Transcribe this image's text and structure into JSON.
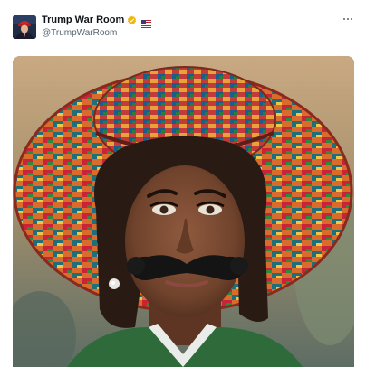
{
  "post": {
    "author": {
      "display_name": "Trump War Room",
      "handle": "@TrumpWarRoom",
      "verified_badge_icon": "verified-check-icon",
      "flag_icon": "us-flag-emoji-icon"
    },
    "menu_icon": "more-horizontal-icon",
    "media": {
      "type": "image",
      "subject_icon": "ai-generated-portrait-image"
    }
  },
  "colors": {
    "display_name": "#0f1419",
    "handle": "#536471",
    "verified_badge": "#f4b400",
    "background": "#ffffff"
  }
}
